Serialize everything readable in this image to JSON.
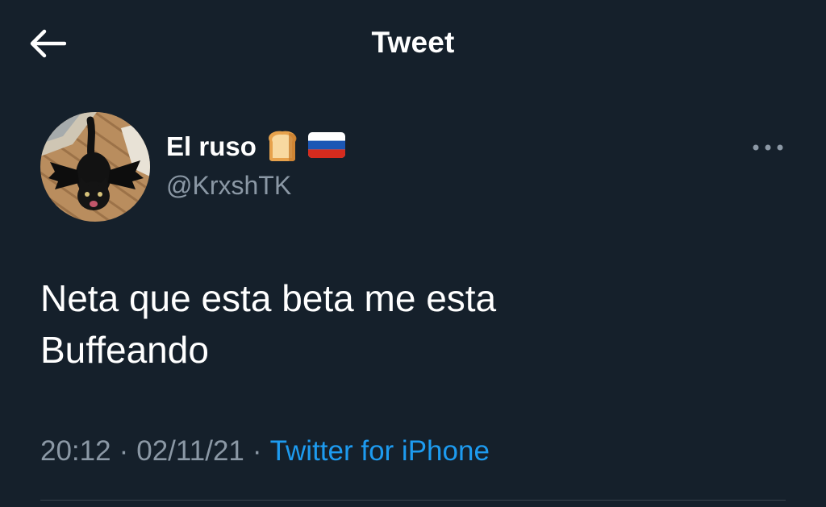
{
  "header": {
    "back_icon": "arrow-left-icon",
    "title": "Tweet"
  },
  "author": {
    "display_name": "El ruso",
    "name_emojis": [
      "bread-emoji",
      "russia-flag-emoji"
    ],
    "handle": "@KrxshTK",
    "avatar_icon": "avatar-black-cat-bat-costume"
  },
  "more_icon": "more-options-icon",
  "tweet": {
    "text": "Neta que esta beta me esta\nBuffeando"
  },
  "meta": {
    "time": "20:12",
    "separator": "·",
    "date": "02/11/21",
    "source": "Twitter for iPhone"
  },
  "colors": {
    "background": "#15202b",
    "secondary_text": "#8b98a5",
    "accent": "#1d9bf0",
    "divider": "#38444d"
  }
}
